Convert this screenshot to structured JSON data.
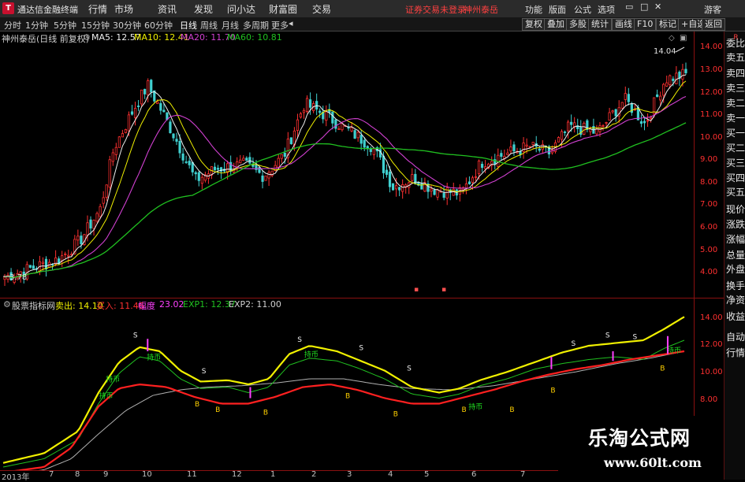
{
  "app": {
    "name": "通达信金融终端",
    "logo": "T"
  },
  "menu": [
    "行情",
    "市场",
    "资讯",
    "发现",
    "问小达",
    "财富圈",
    "交易"
  ],
  "warning": "证券交易未登录",
  "stock_link": "神州泰岳",
  "right_menu": [
    "功能",
    "版面",
    "公式",
    "选项"
  ],
  "vip": "游客",
  "periods": [
    "分时",
    "1分钟",
    "5分钟",
    "15分钟",
    "30分钟",
    "60分钟",
    "日线",
    "周线",
    "月线",
    "多周期",
    "更多"
  ],
  "active_period": "日线",
  "tools": [
    "复权",
    "叠加",
    "多股",
    "统计",
    "画线",
    "F10",
    "标记",
    "+自选",
    "返回"
  ],
  "main_legend": {
    "title": "神州泰岳(日线 前复权)",
    "ma5": "MA5: 12.57",
    "ma10": "MA10: 12.41",
    "ma20": "MA20: 11.70",
    "ma60": "MA60: 10.81",
    "colors": {
      "ma5": "#f0f0f0",
      "ma10": "#f0f000",
      "ma20": "#d040d0",
      "ma60": "#20c020"
    }
  },
  "main_axis": [
    "14.00",
    "13.00",
    "12.00",
    "11.00",
    "10.00",
    "9.00",
    "8.00",
    "7.00",
    "6.00",
    "5.00",
    "4.00"
  ],
  "price_high": "14.04",
  "price_low": "3.78",
  "sub_legend": {
    "title": "股票指标网",
    "sell": "卖出: 14.10",
    "buy": "买入: 11.46",
    "range_label": "幅度",
    "range": "23.02",
    "exp1": "EXP1: 12.37",
    "exp2": "EXP2: 11.00"
  },
  "sub_axis": [
    "14.00",
    "12.00",
    "10.00",
    "8.00"
  ],
  "dates": [
    "2013年",
    "7",
    "8",
    "9",
    "10",
    "11",
    "12",
    "1",
    "2",
    "3",
    "4",
    "5",
    "6",
    "7"
  ],
  "sidebar": [
    "委比",
    "卖五",
    "卖四",
    "卖三",
    "卖二",
    "卖一",
    "买一",
    "买二",
    "买三",
    "买四",
    "买五",
    "现价",
    "涨跌",
    "涨幅",
    "总量",
    "外盘",
    "换手",
    "净资",
    "收益",
    "自动",
    "行情"
  ],
  "sidebar_top": "R",
  "watermark": {
    "title": "乐淘公式网",
    "url": "www.60lt.com"
  },
  "signals": {
    "sell": "S",
    "buy": "B",
    "hold": "持币",
    "buy_text": "买",
    "sell_text": "卖"
  }
}
